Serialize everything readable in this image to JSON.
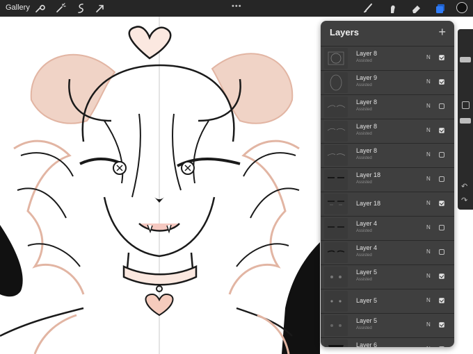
{
  "topbar": {
    "gallery_label": "Gallery",
    "tools_left": [
      "wrench-icon",
      "magic-wand-icon",
      "selection-icon",
      "transform-arrow-icon"
    ],
    "tools_right": [
      "brush-icon",
      "smudge-icon",
      "eraser-icon",
      "layers-icon"
    ],
    "grip": "•••",
    "active_color": "#111111",
    "accent_color": "#2f7bf6"
  },
  "layers_panel": {
    "title": "Layers",
    "add_label": "+",
    "layers": [
      {
        "name": "Layer 8",
        "sub": "Assisted",
        "blend": "N",
        "visible": true
      },
      {
        "name": "Layer 9",
        "sub": "Assisted",
        "blend": "N",
        "visible": true
      },
      {
        "name": "Layer 8",
        "sub": "Assisted",
        "blend": "N",
        "visible": false
      },
      {
        "name": "Layer 8",
        "sub": "Assisted",
        "blend": "N",
        "visible": true
      },
      {
        "name": "Layer 8",
        "sub": "Assisted",
        "blend": "N",
        "visible": false
      },
      {
        "name": "Layer 18",
        "sub": "Assisted",
        "blend": "N",
        "visible": false
      },
      {
        "name": "Layer 18",
        "sub": "",
        "blend": "N",
        "visible": true
      },
      {
        "name": "Layer 4",
        "sub": "Assisted",
        "blend": "N",
        "visible": false
      },
      {
        "name": "Layer 4",
        "sub": "Assisted",
        "blend": "N",
        "visible": false
      },
      {
        "name": "Layer 5",
        "sub": "Assisted",
        "blend": "N",
        "visible": true
      },
      {
        "name": "Layer 5",
        "sub": "",
        "blend": "N",
        "visible": true
      },
      {
        "name": "Layer 5",
        "sub": "Assisted",
        "blend": "N",
        "visible": true
      },
      {
        "name": "Layer 6",
        "sub": "Assisted",
        "blend": "N",
        "visible": true
      }
    ]
  },
  "sidebar": {
    "undo": "↶",
    "redo": "↷"
  },
  "colors": {
    "sketch": "#e2b5a3",
    "ink": "#1a1a1a"
  }
}
